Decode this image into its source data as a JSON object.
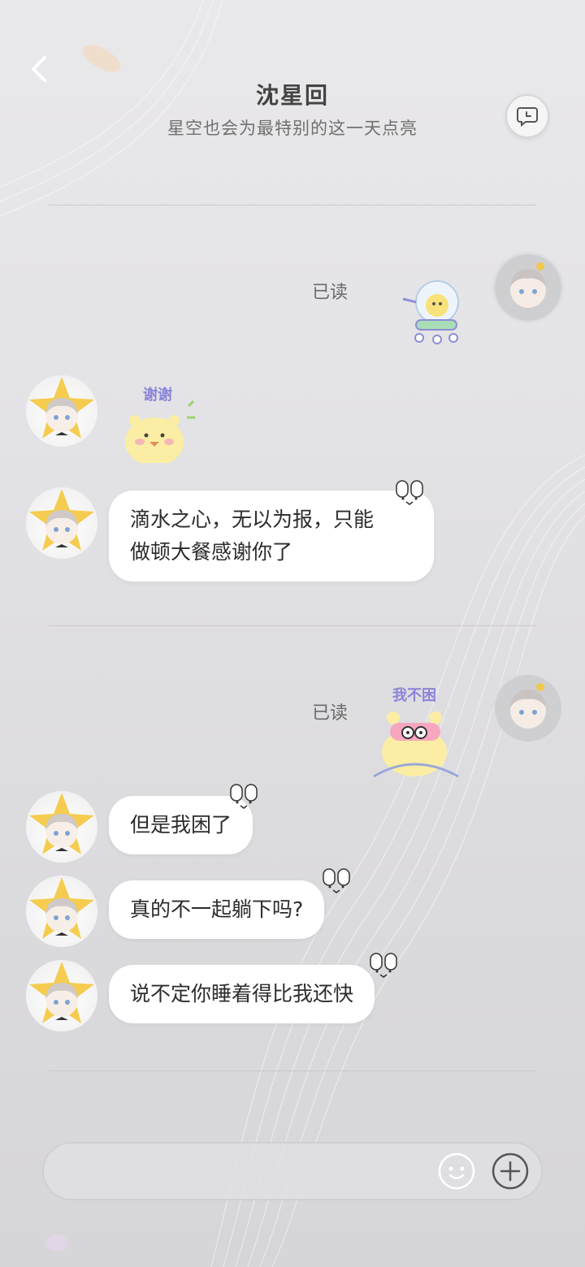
{
  "header": {
    "title": "沈星回",
    "subtitle": "星空也会为最特别的这一天点亮"
  },
  "stickers": {
    "thanks": "谢谢",
    "not_sleepy": "我不困"
  },
  "messages": [
    {
      "from": "me",
      "type": "sticker",
      "status": "已读"
    },
    {
      "from": "him",
      "type": "sticker"
    },
    {
      "from": "him",
      "type": "text",
      "lines": [
        "滴水之心，无以为报，只能",
        "做顿大餐感谢你了"
      ]
    },
    {
      "from": "me",
      "type": "sticker",
      "status": "已读"
    },
    {
      "from": "him",
      "type": "text",
      "text": "但是我困了"
    },
    {
      "from": "him",
      "type": "text",
      "text": "真的不一起躺下吗?"
    },
    {
      "from": "him",
      "type": "text",
      "text": "说不定你睡着得比我还快"
    }
  ],
  "input": {
    "placeholder": ""
  },
  "icons": {
    "back": "chevron-left-icon",
    "header_action": "chat-bubble-icon",
    "emoji": "smiley-icon",
    "plus": "plus-circle-icon"
  }
}
